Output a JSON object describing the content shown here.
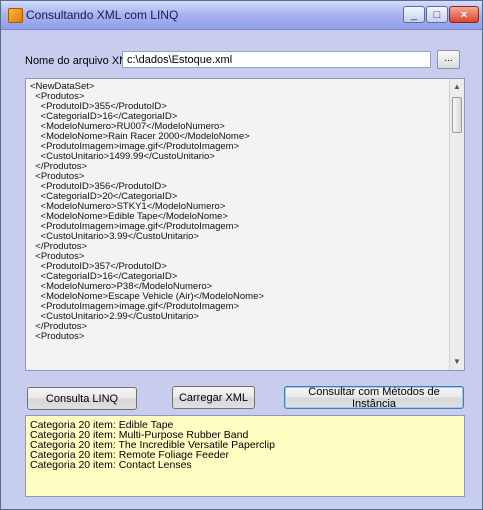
{
  "window": {
    "title": "Consultando XML com LINQ",
    "controls": {
      "minimize": "_",
      "maximize": "□",
      "close": "×"
    }
  },
  "file": {
    "label": "Nome do arquivo XML",
    "value": "c:\\dados\\Estoque.xml",
    "browse_label": "..."
  },
  "xml_lines": [
    "<NewDataSet>",
    "  <Produtos>",
    "    <ProdutoID>355</ProdutoID>",
    "    <CategoriaID>16</CategoriaID>",
    "    <ModeloNumero>RU007</ModeloNumero>",
    "    <ModeloNome>Rain Racer 2000</ModeloNome>",
    "    <ProdutoImagem>image.gif</ProdutoImagem>",
    "    <CustoUnitario>1499.99</CustoUnitario>",
    "  </Produtos>",
    "  <Produtos>",
    "    <ProdutoID>356</ProdutoID>",
    "    <CategoriaID>20</CategoriaID>",
    "    <ModeloNumero>STKY1</ModeloNumero>",
    "    <ModeloNome>Edible Tape</ModeloNome>",
    "    <ProdutoImagem>image.gif</ProdutoImagem>",
    "    <CustoUnitario>3.99</CustoUnitario>",
    "  </Produtos>",
    "  <Produtos>",
    "    <ProdutoID>357</ProdutoID>",
    "    <CategoriaID>16</CategoriaID>",
    "    <ModeloNumero>P38</ModeloNumero>",
    "    <ModeloNome>Escape Vehicle (Air)</ModeloNome>",
    "    <ProdutoImagem>image.gif</ProdutoImagem>",
    "    <CustoUnitario>2.99</CustoUnitario>",
    "  </Produtos>",
    "  <Produtos>"
  ],
  "buttons": {
    "consulta_linq": "Consulta LINQ",
    "carregar_xml": "Carregar XML",
    "consultar_metodos": "Consultar com Métodos de Instância"
  },
  "results": [
    "Categoria 20 item: Edible Tape",
    "Categoria 20 item: Multi-Purpose Rubber Band",
    "Categoria 20 item: The Incredible Versatile Paperclip",
    "Categoria 20 item: Remote Foliage Feeder",
    "Categoria 20 item: Contact Lenses"
  ]
}
